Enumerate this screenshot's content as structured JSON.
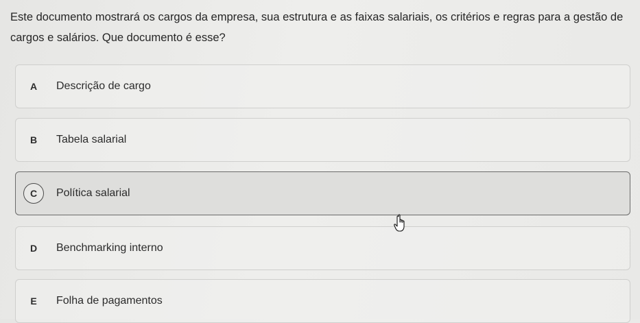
{
  "question": {
    "text": "Este documento mostrará os cargos da empresa, sua estrutura e as faixas salariais, os critérios e regras para a gestão de cargos e salários. Que documento é esse?"
  },
  "options": [
    {
      "letter": "A",
      "text": "Descrição de cargo",
      "selected": false
    },
    {
      "letter": "B",
      "text": "Tabela salarial",
      "selected": false
    },
    {
      "letter": "C",
      "text": "Política salarial",
      "selected": true
    },
    {
      "letter": "D",
      "text": "Benchmarking interno",
      "selected": false
    },
    {
      "letter": "E",
      "text": "Folha de pagamentos",
      "selected": false
    }
  ],
  "cursor": {
    "icon": "hand-pointer-icon"
  }
}
